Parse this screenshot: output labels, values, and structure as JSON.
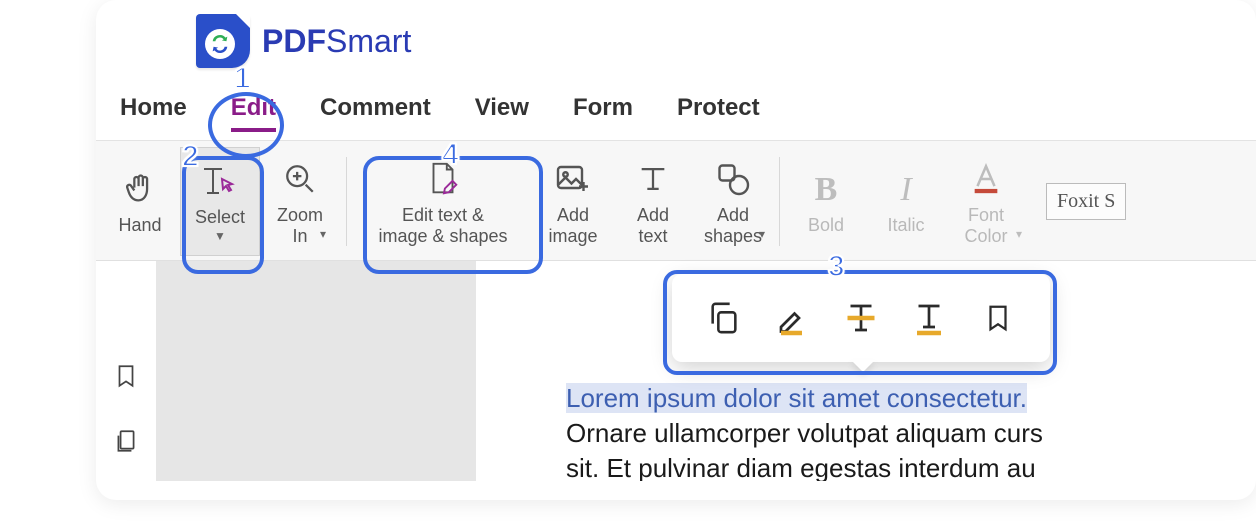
{
  "brand": {
    "bold": "PDF",
    "light": "Smart"
  },
  "tabs": {
    "items": [
      {
        "label": "Home"
      },
      {
        "label": "Edit",
        "active": true
      },
      {
        "label": "Comment"
      },
      {
        "label": "View"
      },
      {
        "label": "Form"
      },
      {
        "label": "Protect"
      }
    ]
  },
  "ribbon": {
    "hand": "Hand",
    "select": "Select",
    "zoom": "Zoom\nIn",
    "edit_tis": "Edit text &\nimage & shapes",
    "add_image": "Add\nimage",
    "add_text": "Add\ntext",
    "add_shapes": "Add\nshapes",
    "bold": "Bold",
    "italic": "Italic",
    "font_color": "Font\nColor",
    "font_box": "Foxit S"
  },
  "doc": {
    "line1": "Lorem ipsum dolor sit amet consectetur.",
    "line2": "Ornare ullamcorper volutpat aliquam curs",
    "line3": "sit. Et pulvinar diam egestas interdum au"
  },
  "callouts": {
    "n1": "1",
    "n2": "2",
    "n3": "3",
    "n4": "4"
  }
}
